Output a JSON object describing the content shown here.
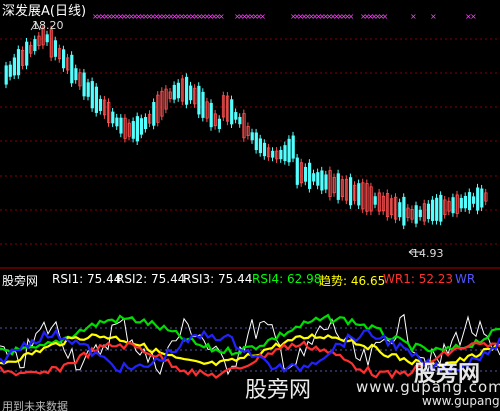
{
  "main_panel": {
    "title": "深发展A(日线)",
    "high_label": "18.20",
    "low_label": "14.93",
    "colors": {
      "up": "#ff5050",
      "down": "#54ffff",
      "grid": "#880000",
      "marker": "#ff44ff"
    }
  },
  "indicator_panel": {
    "name": "股旁网",
    "items": [
      {
        "label": "RSI1: 75.44",
        "color": "#ffffff"
      },
      {
        "label": "RSI2: 75.44",
        "color": "#ffffff"
      },
      {
        "label": "RSI3: 75.44",
        "color": "#ffffff"
      },
      {
        "label": "RSI4: 62.98",
        "color": "#00ff00"
      },
      {
        "label": "趋势: 46.65",
        "color": "#ffff00"
      },
      {
        "label": "WR1: 52.23",
        "color": "#ff3030"
      },
      {
        "label": "WR",
        "color": "#5555ff"
      }
    ]
  },
  "footer": {
    "note": "用到未来数据"
  },
  "watermark": {
    "site_cn": "股旁网",
    "url": "www.gupang.com",
    "logo_cn": "股旁网",
    "logo_url": "www.gupang.com"
  }
}
